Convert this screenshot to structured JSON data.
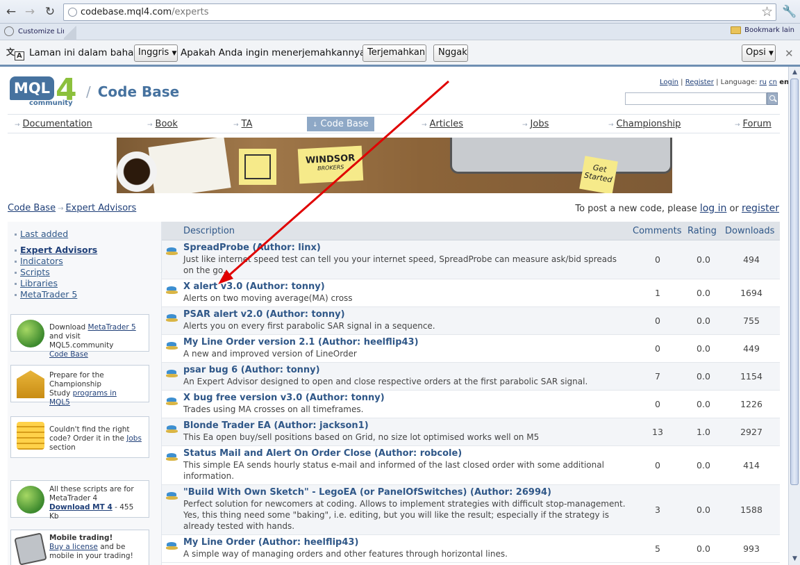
{
  "browser": {
    "url_host": "codebase.mql4.com",
    "url_path": "/experts",
    "bookmark_customize": "Customize Link",
    "bookmark_other": "Bookmark lain"
  },
  "infobar": {
    "text1": "Laman ini dalam bahasa",
    "language": "Inggris",
    "text2": "Apakah Anda ingin menerjemahkannya?",
    "translate_button": "Terjemahkan",
    "no_button": "Nggak",
    "options_button": "Opsi"
  },
  "header": {
    "logo_text": "MQL",
    "logo_number": "4",
    "logo_sub": "community",
    "title": "Code Base",
    "login": "Login",
    "register": "Register",
    "language_label": "Language:",
    "languages": [
      "ru",
      "cn",
      "en"
    ]
  },
  "menu": [
    {
      "label": "Documentation"
    },
    {
      "label": "Book"
    },
    {
      "label": "TA"
    },
    {
      "label": "Code Base"
    },
    {
      "label": "Articles"
    },
    {
      "label": "Jobs"
    },
    {
      "label": "Championship"
    },
    {
      "label": "Forum"
    }
  ],
  "banner": {
    "note_brand": "WINDSOR",
    "note_sub": "BROKERS",
    "note_get": "Get Started"
  },
  "breadcrumb": {
    "root": "Code Base",
    "current": "Expert Advisors"
  },
  "post_note": {
    "text1": "To post a new code, please",
    "login_link": "log in",
    "text2": "or",
    "register_link": "register"
  },
  "sidebar": {
    "last_added": "Last added",
    "categories": [
      "Expert Advisors",
      "Indicators",
      "Scripts",
      "Libraries",
      "MetaTrader 5"
    ],
    "promos": [
      {
        "line1": "Download",
        "link1": "MetaTrader 5",
        "line2": "and visit MQL5.community",
        "link2": "Code Base"
      },
      {
        "line1": "Prepare for the Championship",
        "line2": "Study",
        "link1": "programs in MQL5"
      },
      {
        "line1": "Couldn't find the right code? Order it in the",
        "link1": "Jobs",
        "line2": "section"
      },
      {
        "line1": "All these scripts are for MetaTrader 4",
        "link1": "Download MT 4",
        "line2": "- 455 Kb"
      },
      {
        "line1": "Mobile trading!",
        "link1": "Buy a license",
        "line2": "and be mobile in your trading!"
      }
    ]
  },
  "table": {
    "headers": {
      "description": "Description",
      "comments": "Comments",
      "rating": "Rating",
      "downloads": "Downloads"
    },
    "rows": [
      {
        "title": "SpreadProbe",
        "author": "(Author: linx)",
        "desc": "Just like internet speed test can tell you your internet speed, SpreadProbe can measure ask/bid spreads on the go.",
        "comments": "0",
        "rating": "0.0",
        "downloads": "494"
      },
      {
        "title": "X alert v3.0",
        "author": "(Author: tonny)",
        "desc": "Alerts on two moving average(MA) cross",
        "comments": "1",
        "rating": "0.0",
        "downloads": "1694"
      },
      {
        "title": "PSAR alert v2.0",
        "author": "(Author: tonny)",
        "desc": "Alerts you on every first parabolic SAR signal in a sequence.",
        "comments": "0",
        "rating": "0.0",
        "downloads": "755"
      },
      {
        "title": "My Line Order version 2.1",
        "author": "(Author: heelflip43)",
        "desc": "A new and improved version of LineOrder",
        "comments": "0",
        "rating": "0.0",
        "downloads": "449"
      },
      {
        "title": "psar bug 6",
        "author": "(Author: tonny)",
        "desc": "An Expert Advisor designed to open and close respective orders at the first parabolic SAR signal.",
        "comments": "7",
        "rating": "0.0",
        "downloads": "1154"
      },
      {
        "title": "X bug free version v3.0",
        "author": "(Author: tonny)",
        "desc": "Trades using MA crosses on all timeframes.",
        "comments": "0",
        "rating": "0.0",
        "downloads": "1226"
      },
      {
        "title": "Blonde Trader EA",
        "author": "(Author: jackson1)",
        "desc": "This Ea open buy/sell positions based on Grid, no size lot optimised works well on M5",
        "comments": "13",
        "rating": "1.0",
        "downloads": "2927"
      },
      {
        "title": "Status Mail and Alert On Order Close",
        "author": "(Author: robcole)",
        "desc": "This simple EA sends hourly status e-mail and informed of the last closed order with some additional information.",
        "comments": "0",
        "rating": "0.0",
        "downloads": "414"
      },
      {
        "title": "\"Build With Own Sketch\" - LegoEA (or PanelOfSwitches)",
        "author": "(Author: 26994)",
        "desc": "Perfect solution for newcomers at coding. Allows to implement strategies with difficult stop-management. Yes, this thing need some \"baking\", i.e. editing, but you will like the result; especially if the strategy is already tested with hands.",
        "comments": "3",
        "rating": "0.0",
        "downloads": "1588"
      },
      {
        "title": "My Line Order",
        "author": "(Author: heelflip43)",
        "desc": "A simple way of managing orders and other features through horizontal lines.",
        "comments": "5",
        "rating": "0.0",
        "downloads": "993"
      }
    ]
  },
  "annotation_color": "#e00000"
}
